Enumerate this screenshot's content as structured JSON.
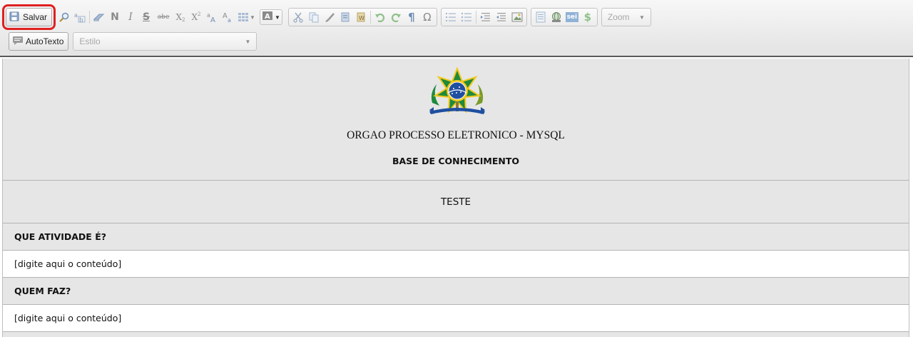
{
  "toolbar": {
    "save_label": "Salvar",
    "autotext_label": "AutoTexto",
    "style_placeholder": "Estilo",
    "zoom_label": "Zoom",
    "format_glyphs": {
      "bold": "N",
      "italic": "I",
      "strike": "S",
      "strike2": "abe",
      "subscript_base": "X",
      "subscript_mark": "2",
      "superscript_base": "X",
      "superscript_mark": "2",
      "pilcrow": "¶",
      "omega": "Ω",
      "sei": "sei",
      "dollar": "$"
    }
  },
  "document": {
    "org": "ORGAO PROCESSO ELETRONICO - MYSQL",
    "subtitle": "BASE DE CONHECIMENTO",
    "title": "TESTE",
    "sections": [
      {
        "heading": "QUE ATIVIDADE É?",
        "content": "[digite aqui o conteúdo]"
      },
      {
        "heading": "QUEM FAZ?",
        "content": "[digite aqui o conteúdo]"
      }
    ]
  },
  "colors": {
    "highlight": "#e02020",
    "header_bg": "#e6e6e6",
    "emblem_green": "#1e8a3c",
    "emblem_yellow": "#f2c81d",
    "emblem_blue": "#1f4fa0"
  }
}
